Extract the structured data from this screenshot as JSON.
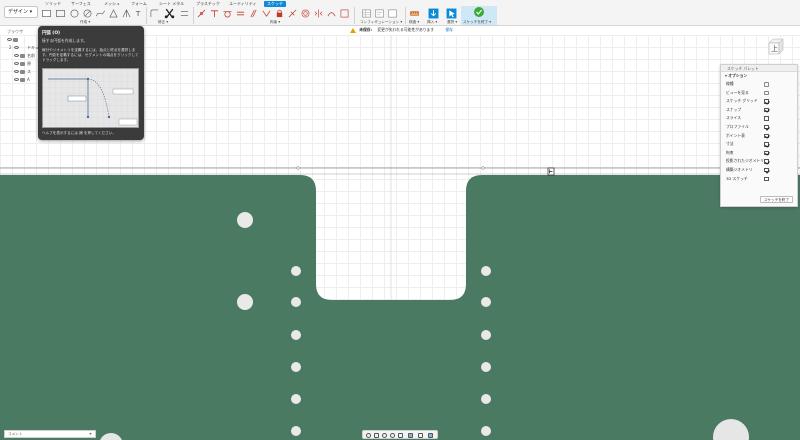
{
  "workspace": {
    "label": "デザイン ▾"
  },
  "tabs": [
    "ソリッド",
    "サーフェス",
    "メッシュ",
    "フォーム",
    "シート メタル",
    "プラスチック",
    "ユーティリティ",
    "スケッチ"
  ],
  "active_tab": "スケッチ",
  "toolbar": {
    "groups": {
      "create": "作成 ▾",
      "modify": "修正 ▾",
      "constraints": "拘束 ▾",
      "configurations": "コンフィギュレーション ▾",
      "inspect": "検査 ▾",
      "insert": "挿入 ▾",
      "select": "選択 ▾",
      "finish": "スケッチを終了 ▾"
    },
    "accent": "#0a8ad8",
    "finish_color": "#3aaa35"
  },
  "infobar": {
    "label": "未保存:",
    "message": "変更が失われる可能性があります",
    "action": "保存"
  },
  "browser": {
    "title": "ブラウザ",
    "rows": [
      {
        "num": "",
        "label": ""
      },
      {
        "num": "2",
        "label": "ドキュ"
      },
      {
        "num": "",
        "label": "名前"
      },
      {
        "num": "",
        "label": "原"
      },
      {
        "num": "",
        "label": "ス"
      },
      {
        "num": "",
        "label": "A"
      }
    ]
  },
  "tooltip": {
    "title": "円弧 (O)",
    "subtitle": "接する円弧を作成します。",
    "description": "線分やジオメトリを定義するには、始点と終点を選択します。円弧を定義するには、セグメントの端点をクリックしてドラッグします。",
    "foot": "ヘルプを表示するには 補 を押してください。"
  },
  "viewcube": {
    "face_label": "上"
  },
  "palette": {
    "header": "スケッチ パレット",
    "section": "▾ オプション",
    "rows": [
      {
        "label": "線種",
        "type": "icon"
      },
      {
        "label": "ビューを見る",
        "type": "icon"
      },
      {
        "label": "スケッチ グリッド",
        "type": "check",
        "on": true
      },
      {
        "label": "スナップ",
        "type": "check",
        "on": true
      },
      {
        "label": "スライス",
        "type": "check",
        "on": false
      },
      {
        "label": "プロファイル",
        "type": "check",
        "on": true
      },
      {
        "label": "ポイント表",
        "type": "check",
        "on": true
      },
      {
        "label": "寸法",
        "type": "check",
        "on": true
      },
      {
        "label": "拘束",
        "type": "check",
        "on": true
      },
      {
        "label": "投影されたジオメトリ",
        "type": "check",
        "on": true
      },
      {
        "label": "構築ジオメトリ",
        "type": "check",
        "on": true
      },
      {
        "label": "3D スケッチ",
        "type": "check",
        "on": false
      }
    ],
    "finish_label": "スケッチを終了"
  },
  "comment_bar": {
    "label": "コメント",
    "plus": "+"
  },
  "part_color": "#4b7a63"
}
